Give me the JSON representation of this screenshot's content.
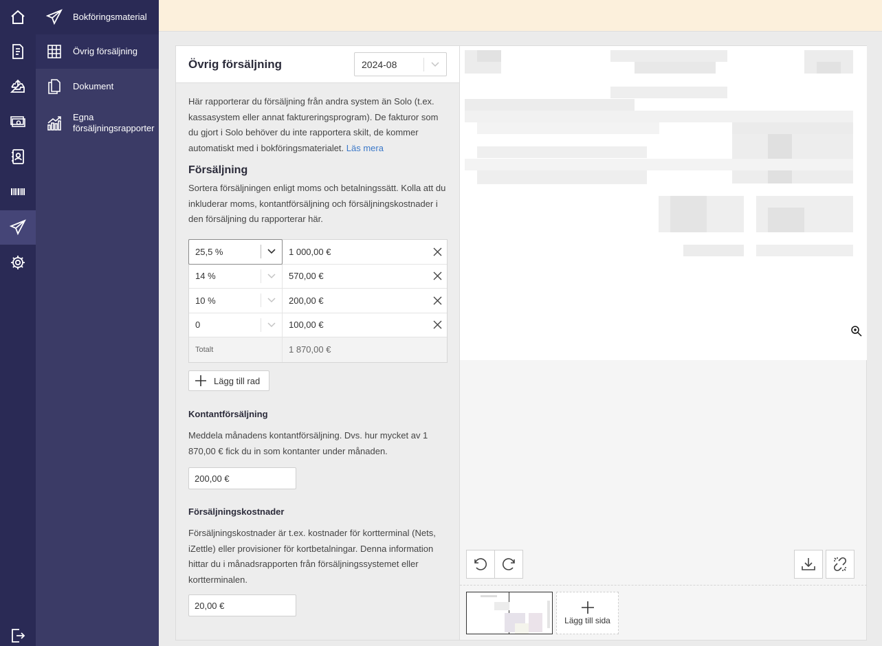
{
  "rail": {
    "icons": [
      "home-icon",
      "receipt-icon",
      "inbox-upload-icon",
      "money-icon",
      "contacts-icon",
      "barcode-icon",
      "paper-plane-icon",
      "gear-icon",
      "logout-icon"
    ],
    "active": "paper-plane-icon"
  },
  "subnav": {
    "items": [
      {
        "label": "Bokföringsmaterial",
        "icon": "paper-plane-icon"
      },
      {
        "label": "Övrig försäljning",
        "icon": "grid-icon"
      },
      {
        "label": "Dokument",
        "icon": "documents-icon"
      },
      {
        "label_line1": "Egna",
        "label_line2": "försäljningsrapporter",
        "icon": "chart-icon"
      }
    ]
  },
  "panel": {
    "title": "Övrig försäljning",
    "period": "2024-08",
    "intro": "Här rapporterar du försäljning från andra system än Solo (t.ex. kassasystem eller annat faktureringsprogram). De fakturor som du gjort i Solo behöver du inte rapportera skilt, de kommer automatiskt med i bokföringsmaterialet.",
    "read_more": "Läs mera",
    "sales_heading": "Försäljning",
    "sales_text": "Sortera försäljningen enligt moms och betalningssätt. Kolla att du inkluderar moms, kontantförsäljning och försäljningskostnader i den försäljning du rapporterar här.",
    "rows": [
      {
        "vat": "25,5 %",
        "amount": "1 000,00 €"
      },
      {
        "vat": "14 %",
        "amount": "570,00 €"
      },
      {
        "vat": "10 %",
        "amount": "200,00 €"
      },
      {
        "vat": "0",
        "amount": "100,00 €"
      }
    ],
    "total_label": "Totalt",
    "total_value": "1 870,00 €",
    "add_row_label": "Lägg till rad",
    "cash_heading": "Kontantförsäljning",
    "cash_text": "Meddela månadens kontantförsäljning. Dvs. hur mycket av 1 870,00 € fick du in som kontanter under månaden.",
    "cash_value": "200,00 €",
    "costs_heading": "Försäljningskostnader",
    "costs_text": "Försäljningskostnader är t.ex. kostnader för kortterminal (Nets, iZettle) eller provisioner för kortbetalningar. Denna information hittar du i månadsrapporten från försäljningssystemet eller kortterminalen.",
    "costs_value": "20,00 €"
  },
  "preview": {
    "add_page_label": "Lägg till sida",
    "tools": [
      "rotate-left-icon",
      "rotate-right-icon",
      "download-icon",
      "unlink-icon",
      "zoom-in-icon"
    ]
  },
  "colors": {
    "rail": "#2a2a55",
    "subnav": "#3b3b66",
    "topbar": "#fcf0dc",
    "link": "#3b78c8"
  }
}
